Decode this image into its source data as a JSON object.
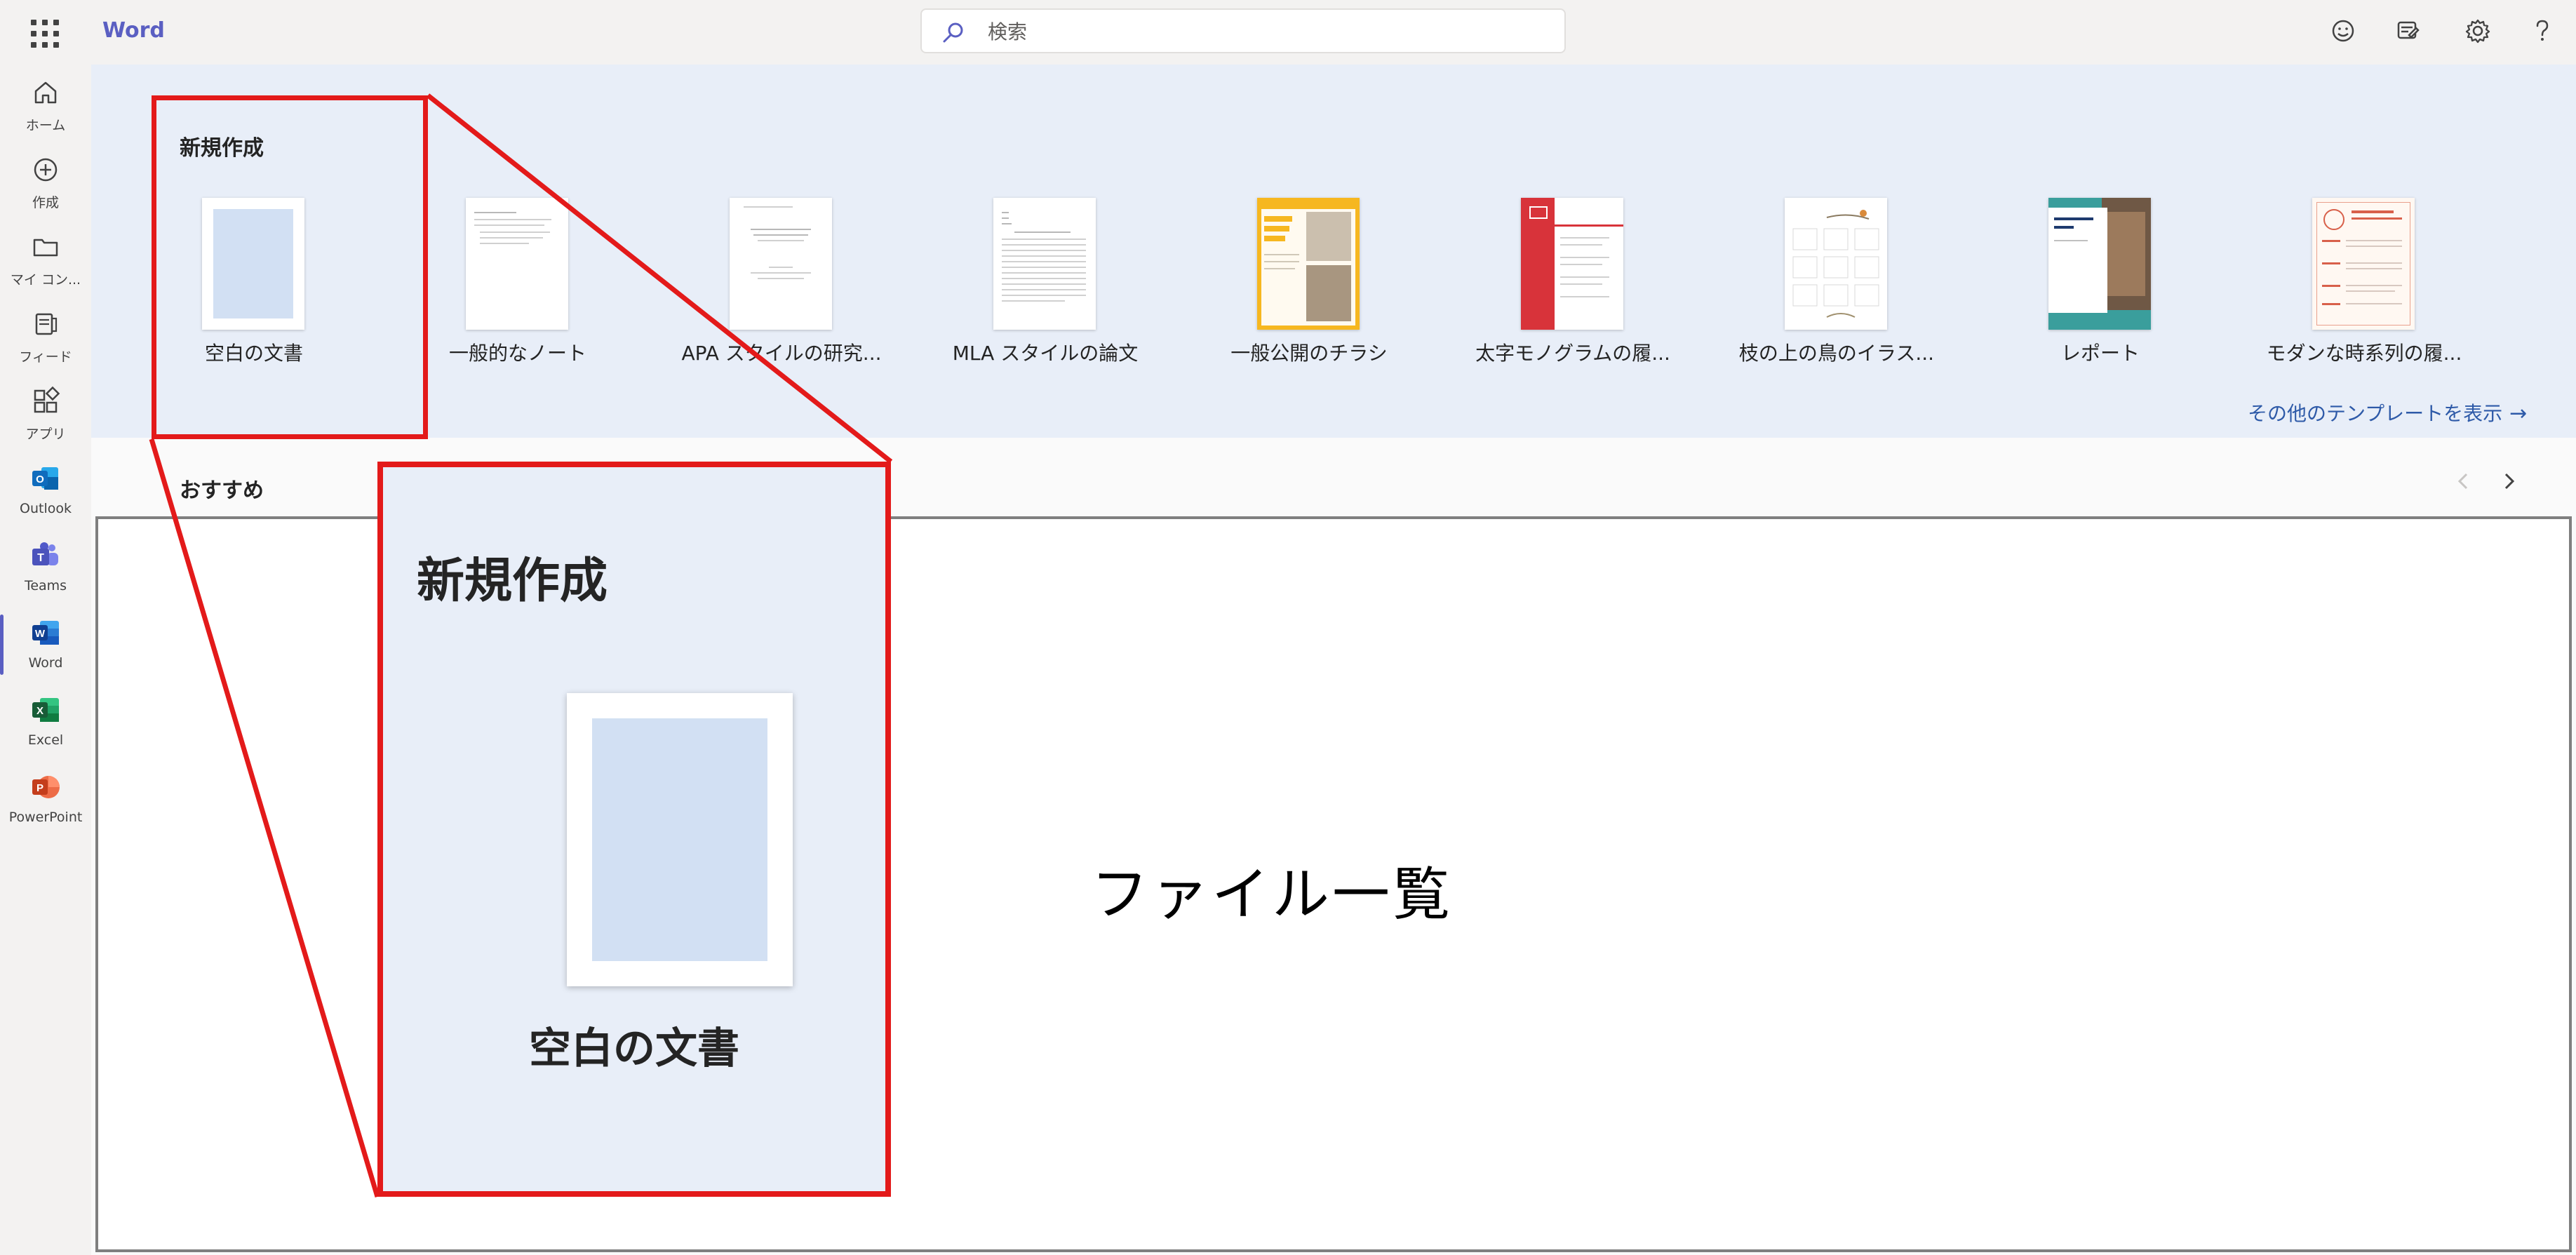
{
  "header": {
    "app_name": "Word",
    "search_placeholder": "検索"
  },
  "rail": {
    "items": [
      {
        "label": "ホーム",
        "icon": "home-icon"
      },
      {
        "label": "作成",
        "icon": "create-icon"
      },
      {
        "label": "マイ コン...",
        "icon": "folder-icon"
      },
      {
        "label": "フィード",
        "icon": "feed-icon"
      },
      {
        "label": "アプリ",
        "icon": "apps-icon"
      },
      {
        "label": "Outlook",
        "icon": "outlook-icon"
      },
      {
        "label": "Teams",
        "icon": "teams-icon"
      },
      {
        "label": "Word",
        "icon": "word-icon"
      },
      {
        "label": "Excel",
        "icon": "excel-icon"
      },
      {
        "label": "PowerPoint",
        "icon": "powerpoint-icon"
      }
    ]
  },
  "new_section": {
    "heading": "新規作成",
    "templates": [
      {
        "name": "空白の文書"
      },
      {
        "name": "一般的なノート"
      },
      {
        "name": "APA スタイルの研究..."
      },
      {
        "name": "MLA スタイルの論文"
      },
      {
        "name": "一般公開のチラシ"
      },
      {
        "name": "太字モノグラムの履..."
      },
      {
        "name": "枝の上の鳥のイラス..."
      },
      {
        "name": "レポート"
      },
      {
        "name": "モダンな時系列の履..."
      }
    ],
    "more_templates": "その他のテンプレートを表示"
  },
  "recommended": {
    "heading": "おすすめ"
  },
  "file_list": {
    "label": "ファイル一覧"
  },
  "callout": {
    "heading": "新規作成",
    "template_name": "空白の文書"
  },
  "colors": {
    "accent": "#5a5fc2",
    "highlight": "#e31a1a",
    "band": "#e8eef8"
  }
}
